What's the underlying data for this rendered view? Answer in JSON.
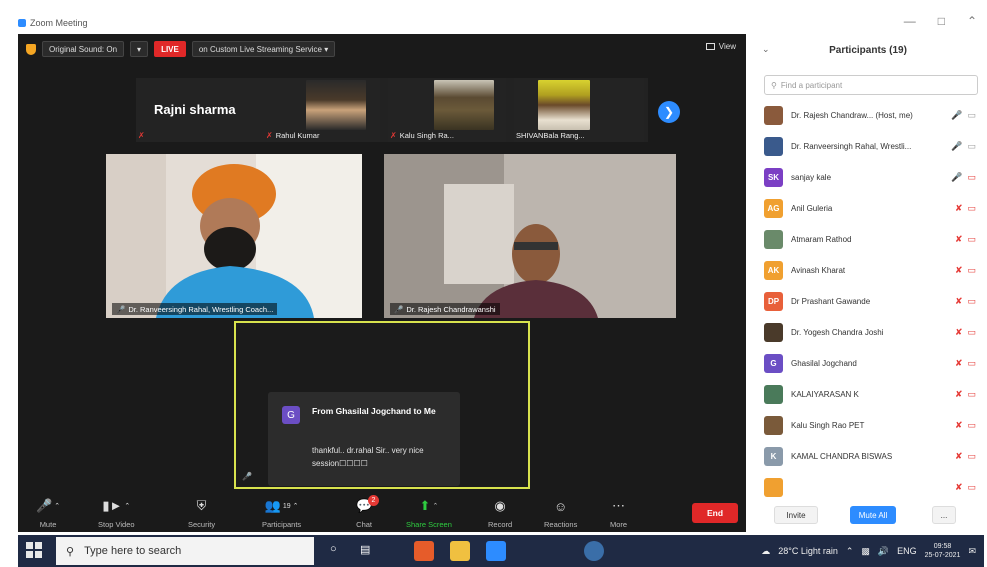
{
  "window": {
    "title": "Zoom Meeting"
  },
  "topbar": {
    "original_sound": "Original Sound: On",
    "live_badge": "LIVE",
    "streaming": "on Custom Live Streaming Service",
    "view": "View"
  },
  "filmstrip": {
    "tiles": [
      {
        "name": "Rajni sharma",
        "label": ""
      },
      {
        "name": "",
        "label": "Rahul Kumar"
      },
      {
        "name": "",
        "label": "Kalu Singh Ra..."
      },
      {
        "name": "",
        "label": "SHIVANBala Rang..."
      }
    ]
  },
  "videos": [
    {
      "caption": "Dr. Ranveersingh Rahal, Wrestling Coach..."
    },
    {
      "caption": "Dr. Rajesh Chandrawanshi"
    }
  ],
  "chat_popup": {
    "avatar_letter": "G",
    "from": "From Ghasilal Jogchand to Me",
    "message": "thankful.. dr.rahal Sir.. very nice session☐☐☐☐"
  },
  "toolbar": {
    "mute": "Mute",
    "stop_video": "Stop Video",
    "security": "Security",
    "participants": "Participants",
    "participants_count": "19",
    "chat": "Chat",
    "chat_badge": "2",
    "share_screen": "Share Screen",
    "record": "Record",
    "reactions": "Reactions",
    "more": "More",
    "end": "End"
  },
  "panel": {
    "title": "Participants (19)",
    "search_placeholder": "Find a participant",
    "participants": [
      {
        "initials": "",
        "color": "#8a5a3c",
        "name": "Dr. Rajesh Chandraw...  (Host, me)",
        "mic": "on",
        "cam": "on"
      },
      {
        "initials": "",
        "color": "#3a5a8c",
        "name": "Dr. Ranveersingh Rahal, Wrestli...",
        "mic": "on",
        "cam": "on"
      },
      {
        "initials": "SK",
        "color": "#7b3fc4",
        "name": "sanjay kale",
        "mic": "on",
        "cam": "off"
      },
      {
        "initials": "AG",
        "color": "#f0a030",
        "name": "Anil Guleria",
        "mic": "off",
        "cam": "off"
      },
      {
        "initials": "",
        "color": "#6a8a6a",
        "name": "Atmaram Rathod",
        "mic": "off",
        "cam": "off"
      },
      {
        "initials": "AK",
        "color": "#f0a030",
        "name": "Avinash Kharat",
        "mic": "off",
        "cam": "off"
      },
      {
        "initials": "DP",
        "color": "#e8603a",
        "name": "Dr Prashant Gawande",
        "mic": "off",
        "cam": "off"
      },
      {
        "initials": "",
        "color": "#4a3a2a",
        "name": "Dr. Yogesh Chandra Joshi",
        "mic": "off",
        "cam": "off"
      },
      {
        "initials": "G",
        "color": "#6b4ec4",
        "name": "Ghasilal Jogchand",
        "mic": "off",
        "cam": "off"
      },
      {
        "initials": "",
        "color": "#4a7a5a",
        "name": "KALAIYARASAN K",
        "mic": "off",
        "cam": "off"
      },
      {
        "initials": "",
        "color": "#7a5a3a",
        "name": "Kalu Singh Rao PET",
        "mic": "off",
        "cam": "off"
      },
      {
        "initials": "K",
        "color": "#8a9aaa",
        "name": "KAMAL CHANDRA BISWAS",
        "mic": "off",
        "cam": "off"
      },
      {
        "initials": "",
        "color": "#f0a030",
        "name": "",
        "mic": "off",
        "cam": "off"
      }
    ],
    "invite": "Invite",
    "mute_all": "Mute All",
    "more": "..."
  },
  "taskbar": {
    "search_placeholder": "Type here to search",
    "weather": "28°C  Light rain",
    "lang": "ENG",
    "time": "09:58",
    "date": "25-07-2021"
  }
}
